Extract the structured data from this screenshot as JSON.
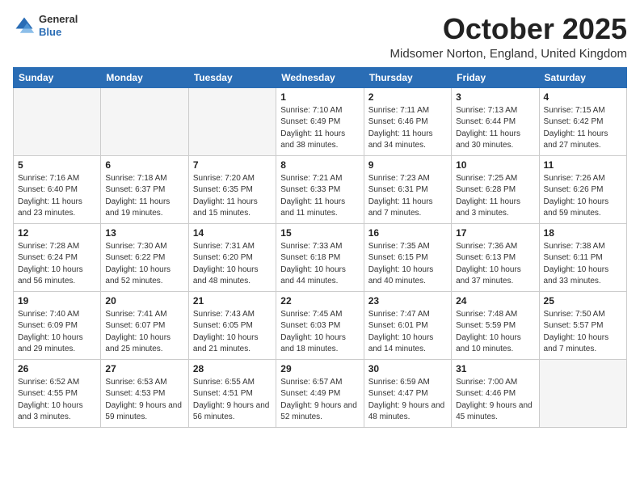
{
  "logo": {
    "general": "General",
    "blue": "Blue"
  },
  "header": {
    "month": "October 2025",
    "location": "Midsomer Norton, England, United Kingdom"
  },
  "weekdays": [
    "Sunday",
    "Monday",
    "Tuesday",
    "Wednesday",
    "Thursday",
    "Friday",
    "Saturday"
  ],
  "weeks": [
    [
      {
        "day": "",
        "detail": ""
      },
      {
        "day": "",
        "detail": ""
      },
      {
        "day": "",
        "detail": ""
      },
      {
        "day": "1",
        "detail": "Sunrise: 7:10 AM\nSunset: 6:49 PM\nDaylight: 11 hours\nand 38 minutes."
      },
      {
        "day": "2",
        "detail": "Sunrise: 7:11 AM\nSunset: 6:46 PM\nDaylight: 11 hours\nand 34 minutes."
      },
      {
        "day": "3",
        "detail": "Sunrise: 7:13 AM\nSunset: 6:44 PM\nDaylight: 11 hours\nand 30 minutes."
      },
      {
        "day": "4",
        "detail": "Sunrise: 7:15 AM\nSunset: 6:42 PM\nDaylight: 11 hours\nand 27 minutes."
      }
    ],
    [
      {
        "day": "5",
        "detail": "Sunrise: 7:16 AM\nSunset: 6:40 PM\nDaylight: 11 hours\nand 23 minutes."
      },
      {
        "day": "6",
        "detail": "Sunrise: 7:18 AM\nSunset: 6:37 PM\nDaylight: 11 hours\nand 19 minutes."
      },
      {
        "day": "7",
        "detail": "Sunrise: 7:20 AM\nSunset: 6:35 PM\nDaylight: 11 hours\nand 15 minutes."
      },
      {
        "day": "8",
        "detail": "Sunrise: 7:21 AM\nSunset: 6:33 PM\nDaylight: 11 hours\nand 11 minutes."
      },
      {
        "day": "9",
        "detail": "Sunrise: 7:23 AM\nSunset: 6:31 PM\nDaylight: 11 hours\nand 7 minutes."
      },
      {
        "day": "10",
        "detail": "Sunrise: 7:25 AM\nSunset: 6:28 PM\nDaylight: 11 hours\nand 3 minutes."
      },
      {
        "day": "11",
        "detail": "Sunrise: 7:26 AM\nSunset: 6:26 PM\nDaylight: 10 hours\nand 59 minutes."
      }
    ],
    [
      {
        "day": "12",
        "detail": "Sunrise: 7:28 AM\nSunset: 6:24 PM\nDaylight: 10 hours\nand 56 minutes."
      },
      {
        "day": "13",
        "detail": "Sunrise: 7:30 AM\nSunset: 6:22 PM\nDaylight: 10 hours\nand 52 minutes."
      },
      {
        "day": "14",
        "detail": "Sunrise: 7:31 AM\nSunset: 6:20 PM\nDaylight: 10 hours\nand 48 minutes."
      },
      {
        "day": "15",
        "detail": "Sunrise: 7:33 AM\nSunset: 6:18 PM\nDaylight: 10 hours\nand 44 minutes."
      },
      {
        "day": "16",
        "detail": "Sunrise: 7:35 AM\nSunset: 6:15 PM\nDaylight: 10 hours\nand 40 minutes."
      },
      {
        "day": "17",
        "detail": "Sunrise: 7:36 AM\nSunset: 6:13 PM\nDaylight: 10 hours\nand 37 minutes."
      },
      {
        "day": "18",
        "detail": "Sunrise: 7:38 AM\nSunset: 6:11 PM\nDaylight: 10 hours\nand 33 minutes."
      }
    ],
    [
      {
        "day": "19",
        "detail": "Sunrise: 7:40 AM\nSunset: 6:09 PM\nDaylight: 10 hours\nand 29 minutes."
      },
      {
        "day": "20",
        "detail": "Sunrise: 7:41 AM\nSunset: 6:07 PM\nDaylight: 10 hours\nand 25 minutes."
      },
      {
        "day": "21",
        "detail": "Sunrise: 7:43 AM\nSunset: 6:05 PM\nDaylight: 10 hours\nand 21 minutes."
      },
      {
        "day": "22",
        "detail": "Sunrise: 7:45 AM\nSunset: 6:03 PM\nDaylight: 10 hours\nand 18 minutes."
      },
      {
        "day": "23",
        "detail": "Sunrise: 7:47 AM\nSunset: 6:01 PM\nDaylight: 10 hours\nand 14 minutes."
      },
      {
        "day": "24",
        "detail": "Sunrise: 7:48 AM\nSunset: 5:59 PM\nDaylight: 10 hours\nand 10 minutes."
      },
      {
        "day": "25",
        "detail": "Sunrise: 7:50 AM\nSunset: 5:57 PM\nDaylight: 10 hours\nand 7 minutes."
      }
    ],
    [
      {
        "day": "26",
        "detail": "Sunrise: 6:52 AM\nSunset: 4:55 PM\nDaylight: 10 hours\nand 3 minutes."
      },
      {
        "day": "27",
        "detail": "Sunrise: 6:53 AM\nSunset: 4:53 PM\nDaylight: 9 hours\nand 59 minutes."
      },
      {
        "day": "28",
        "detail": "Sunrise: 6:55 AM\nSunset: 4:51 PM\nDaylight: 9 hours\nand 56 minutes."
      },
      {
        "day": "29",
        "detail": "Sunrise: 6:57 AM\nSunset: 4:49 PM\nDaylight: 9 hours\nand 52 minutes."
      },
      {
        "day": "30",
        "detail": "Sunrise: 6:59 AM\nSunset: 4:47 PM\nDaylight: 9 hours\nand 48 minutes."
      },
      {
        "day": "31",
        "detail": "Sunrise: 7:00 AM\nSunset: 4:46 PM\nDaylight: 9 hours\nand 45 minutes."
      },
      {
        "day": "",
        "detail": ""
      }
    ]
  ]
}
